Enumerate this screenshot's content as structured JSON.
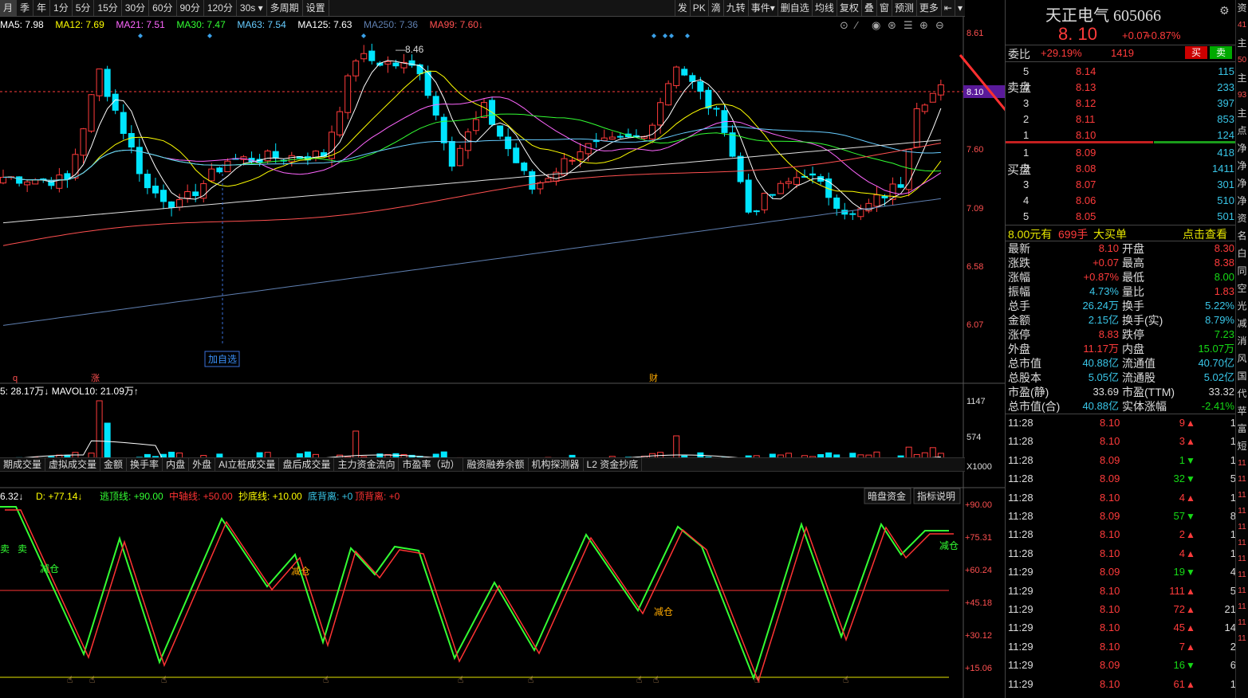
{
  "toolbar": {
    "periods": [
      "月",
      "季",
      "年",
      "1分",
      "5分",
      "15分",
      "30分",
      "60分",
      "90分",
      "120分",
      "30s ▾",
      "多周期",
      "设置"
    ],
    "selected_index": 0,
    "right_buttons": [
      "发",
      "PK",
      "滴",
      "九转",
      "事件▾",
      "删自选",
      "均线",
      "复权",
      "叠",
      "窗",
      "预测",
      "更多",
      "⇤",
      "▾"
    ]
  },
  "ma_legend": [
    {
      "text": "MA5: 7.98",
      "color": "#ffffff"
    },
    {
      "text": "MA12: 7.69",
      "color": "#ffff00"
    },
    {
      "text": "MA21: 7.51",
      "color": "#ff66ff"
    },
    {
      "text": "MA30: 7.47",
      "color": "#33ff33"
    },
    {
      "text": "MA63: 7.54",
      "color": "#66ccff"
    },
    {
      "text": "MA125: 7.63",
      "color": "#ffffff"
    },
    {
      "text": "MA250: 7.36",
      "color": "#5f7fb0"
    },
    {
      "text": "MA99: 7.60↓",
      "color": "#ff5050"
    }
  ],
  "price_axis": [
    "8.61",
    "8.10",
    "7.60",
    "7.09",
    "6.58",
    "6.07"
  ],
  "current_price_tag": "8.10",
  "high_label": "8.46",
  "add_watch_label": "加自选",
  "event_marks": [
    "q",
    "涨",
    "财"
  ],
  "volume": {
    "legend": "5: 28.17万↓ MAVOL10: 21.09万↑",
    "axis": [
      "1147",
      "574",
      "X1000"
    ]
  },
  "tabs": [
    "期成交量",
    "虚拟成交量",
    "金额",
    "换手率",
    "内盘",
    "外盘",
    "AI立桩成交量",
    "盘后成交量",
    "主力资金流向",
    "市盈率（动）",
    "融资融券余额",
    "机构探测器",
    "L2 资金抄底"
  ],
  "oscillator": {
    "legend": [
      {
        "text": "6.32↓",
        "color": "#ffffff"
      },
      {
        "text": "D: +77.14↓",
        "color": "#ffff00"
      },
      {
        "text": "逃顶线: +90.00",
        "color": "#33ff33"
      },
      {
        "text": "中轴线: +50.00",
        "color": "#ff3333"
      },
      {
        "text": "抄底线: +10.00",
        "color": "#ffff00"
      },
      {
        "text": "底背离: +0",
        "color": "#39c6e8"
      },
      {
        "text": "顶背离: +0",
        "color": "#ff3333"
      }
    ],
    "buttons": [
      "暗盘资金",
      "指标说明"
    ],
    "axis": [
      "+90.00",
      "+75.31",
      "+60.24",
      "+45.18",
      "+30.12",
      "+15.06"
    ],
    "labels": [
      "卖",
      "卖",
      "减仓",
      "减仓",
      "减仓",
      "减仓"
    ]
  },
  "quote": {
    "name": "天正电气",
    "code": "605066",
    "price": "8. 10",
    "change": "+0.07",
    "pct": "+0.87%",
    "weibi_label": "委比",
    "weibi": "+29.19%",
    "weicha": "1419",
    "sell_btn": "买",
    "buy_btn": "卖",
    "side_sell": "卖盘",
    "side_buy": "买盘",
    "asks": [
      {
        "lvl": "5",
        "p": "8.14",
        "v": "115"
      },
      {
        "lvl": "4",
        "p": "8.13",
        "v": "233"
      },
      {
        "lvl": "3",
        "p": "8.12",
        "v": "397"
      },
      {
        "lvl": "2",
        "p": "8.11",
        "v": "853"
      },
      {
        "lvl": "1",
        "p": "8.10",
        "v": "124"
      }
    ],
    "bids": [
      {
        "lvl": "1",
        "p": "8.09",
        "v": "418"
      },
      {
        "lvl": "2",
        "p": "8.08",
        "v": "1411"
      },
      {
        "lvl": "3",
        "p": "8.07",
        "v": "301"
      },
      {
        "lvl": "4",
        "p": "8.06",
        "v": "510"
      },
      {
        "lvl": "5",
        "p": "8.05",
        "v": "501"
      }
    ],
    "bigorder": {
      "price": "8.00元有",
      "qty": "699手",
      "label": "大买单",
      "link": "点击查看"
    },
    "stats": [
      [
        "最新",
        "8.10",
        "red",
        "开盘",
        "8.30",
        "red"
      ],
      [
        "涨跌",
        "+0.07",
        "red",
        "最高",
        "8.38",
        "red"
      ],
      [
        "涨幅",
        "+0.87%",
        "red",
        "最低",
        "8.00",
        "grn"
      ],
      [
        "振幅",
        "4.73%",
        "cyn",
        "量比",
        "1.83",
        "red"
      ],
      [
        "总手",
        "26.24万",
        "cyn",
        "换手",
        "5.22%",
        "cyn"
      ],
      [
        "金额",
        "2.15亿",
        "cyn",
        "换手(实)",
        "8.79%",
        "cyn"
      ],
      [
        "涨停",
        "8.83",
        "red",
        "跌停",
        "7.23",
        "grn"
      ],
      [
        "外盘",
        "11.17万",
        "red",
        "内盘",
        "15.07万",
        "grn"
      ],
      [
        "总市值",
        "40.88亿",
        "cyn",
        "流通值",
        "40.70亿",
        "cyn"
      ],
      [
        "总股本",
        "5.05亿",
        "cyn",
        "流通股",
        "5.02亿",
        "cyn"
      ],
      [
        "市盈(静)",
        "33.69",
        "wht",
        "市盈(TTM)",
        "33.32",
        "wht"
      ],
      [
        "总市值(合)",
        "40.88亿",
        "cyn",
        "实体涨幅",
        "-2.41%",
        "grn"
      ]
    ],
    "ticks": [
      {
        "t": "11:28",
        "p": "8.10",
        "pc": "red",
        "v": "9",
        "d": "up",
        "n": "1"
      },
      {
        "t": "11:28",
        "p": "8.10",
        "pc": "red",
        "v": "3",
        "d": "up",
        "n": "1"
      },
      {
        "t": "11:28",
        "p": "8.09",
        "pc": "red",
        "v": "1",
        "d": "dn",
        "n": "1"
      },
      {
        "t": "11:28",
        "p": "8.09",
        "pc": "red",
        "v": "32",
        "d": "dn",
        "n": "5"
      },
      {
        "t": "11:28",
        "p": "8.10",
        "pc": "red",
        "v": "4",
        "d": "up",
        "n": "1"
      },
      {
        "t": "11:28",
        "p": "8.09",
        "pc": "red",
        "v": "57",
        "d": "dn",
        "n": "8"
      },
      {
        "t": "11:28",
        "p": "8.10",
        "pc": "red",
        "v": "2",
        "d": "up",
        "n": "1"
      },
      {
        "t": "11:28",
        "p": "8.10",
        "pc": "red",
        "v": "4",
        "d": "up",
        "n": "1"
      },
      {
        "t": "11:29",
        "p": "8.09",
        "pc": "red",
        "v": "19",
        "d": "dn",
        "n": "4"
      },
      {
        "t": "11:29",
        "p": "8.10",
        "pc": "red",
        "v": "111",
        "d": "up",
        "n": "5"
      },
      {
        "t": "11:29",
        "p": "8.10",
        "pc": "red",
        "v": "72",
        "d": "up",
        "n": "21"
      },
      {
        "t": "11:29",
        "p": "8.10",
        "pc": "red",
        "v": "45",
        "d": "up",
        "n": "14"
      },
      {
        "t": "11:29",
        "p": "8.10",
        "pc": "red",
        "v": "7",
        "d": "up",
        "n": "2"
      },
      {
        "t": "11:29",
        "p": "8.09",
        "pc": "red",
        "v": "16",
        "d": "dn",
        "n": "6"
      },
      {
        "t": "11:29",
        "p": "8.10",
        "pc": "red",
        "v": "61",
        "d": "up",
        "n": "1"
      }
    ],
    "vstrip": [
      "资",
      "41",
      "主",
      "50",
      "主",
      "93",
      "主",
      "点",
      "净",
      "净",
      "净",
      "净",
      "资",
      "名",
      "白",
      "同",
      "空",
      "光",
      "减",
      "消",
      "风",
      "国",
      "代",
      "苹",
      "富",
      "短",
      "11",
      "11",
      "11",
      "11",
      "11",
      "11",
      "11",
      "11",
      "11",
      "11",
      "11",
      "11"
    ]
  },
  "colors": {
    "up": "#ff3b3b",
    "down": "#00e5ff",
    "ma5": "#ffffff",
    "ma12": "#ffff00",
    "ma21": "#ff66ff",
    "ma30": "#33ff33",
    "ma63": "#66ccff",
    "ma250": "#5f7fb0",
    "ma99": "#ff5050"
  }
}
